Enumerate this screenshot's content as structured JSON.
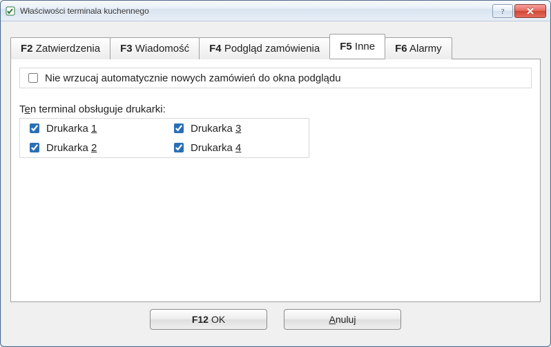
{
  "window": {
    "title": "Właściwości terminala kuchennego"
  },
  "tabs": [
    {
      "fkey": "F2",
      "label": "Zatwierdzenia",
      "active": false
    },
    {
      "fkey": "F3",
      "label": "Wiadomość",
      "active": false
    },
    {
      "fkey": "F4",
      "label": "Podgląd zamówienia",
      "active": false
    },
    {
      "fkey": "F5",
      "label": "Inne",
      "active": true
    },
    {
      "fkey": "F6",
      "label": "Alarmy",
      "active": false
    }
  ],
  "panel": {
    "dontThrowIn": {
      "checked": false,
      "label": "Nie wrzucaj automatycznie nowych zamówień do okna podglądu"
    },
    "sectionLabel": {
      "pre": "T",
      "accel": "e",
      "post": "n terminal obsługuje drukarki:"
    },
    "printers": [
      {
        "label": "Drukarka ",
        "accel": "1",
        "checked": true
      },
      {
        "label": "Drukarka ",
        "accel": "3",
        "checked": true
      },
      {
        "label": "Drukarka ",
        "accel": "2",
        "checked": true
      },
      {
        "label": "Drukarka ",
        "accel": "4",
        "checked": true
      }
    ]
  },
  "buttons": {
    "ok": {
      "fkey": "F12",
      "label": "OK"
    },
    "cancel": {
      "pre": "",
      "accel": "A",
      "post": "nuluj"
    }
  }
}
